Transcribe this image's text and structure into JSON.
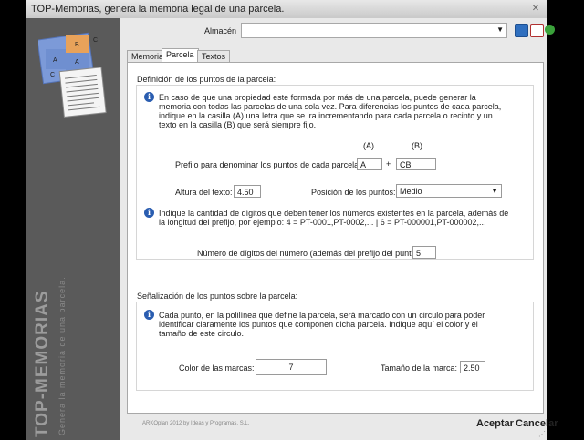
{
  "window": {
    "title": "TOP-Memorias, genera la memoria legal de una parcela."
  },
  "sidebar": {
    "brand": "TOP-MEMORIAS",
    "tagline": "Genera la memoria de una parcela.",
    "logo_letters": [
      "A",
      "B",
      "A",
      "C",
      "B",
      "C"
    ]
  },
  "toolbar": {
    "almacen_label": "Almacén",
    "almacen_value": ""
  },
  "tabs": [
    {
      "label": "Memoria"
    },
    {
      "label": "Parcela"
    },
    {
      "label": "Textos"
    }
  ],
  "parcela": {
    "group_title": "Definición de los puntos de la parcela:",
    "info1": "En caso de que una propiedad este formada por más de una parcela, puede generar la memoria con todas las parcelas de una sola vez. Para diferencias los puntos de cada parcela, indique en la casilla (A) una letra que se ira incrementando para cada parcela o recinto y un texto en la casilla (B) que será siempre fijo.",
    "col_a": "(A)",
    "col_b": "(B)",
    "prefijo_label": "Prefijo para denominar los puntos de cada parcela:",
    "prefijo_a": "A",
    "plus": "+",
    "prefijo_b": "CB",
    "altura_label": "Altura del texto:",
    "altura_value": "4.50",
    "posicion_label": "Posición de los puntos:",
    "posicion_value": "Medio",
    "info2": "Indique la cantidad de dígitos que deben tener los números existentes en la parcela, además de la longitud del prefijo, por ejemplo:  4 = PT-0001,PT-0002,...   |   6 = PT-000001,PT-000002,...",
    "digitos_label": "Número de dígitos del número (además del prefijo del punto):",
    "digitos_value": "5"
  },
  "senalizacion": {
    "group_title": "Señalización de los puntos sobre la parcela:",
    "info": "Cada punto, en la polilínea que define la parcela, será marcado con un circulo para poder identificar claramente los puntos que componen dicha parcela. Indique aquí el color y el tamaño de este circulo.",
    "color_label": "Color de las marcas:",
    "color_value": "7",
    "tamano_label": "Tamaño de la marca:",
    "tamano_value": "2.50"
  },
  "footer": {
    "copyright": "ARKOplan 2012 by Ideas y Programas, S.L.",
    "accept": "Aceptar",
    "cancel": "Cancelar"
  },
  "colors": {
    "logo_blue": "#6f8fd0",
    "logo_orange": "#e8a25a",
    "sidebar_bg": "#5a5a5a",
    "info_blue": "#2a5db0"
  }
}
